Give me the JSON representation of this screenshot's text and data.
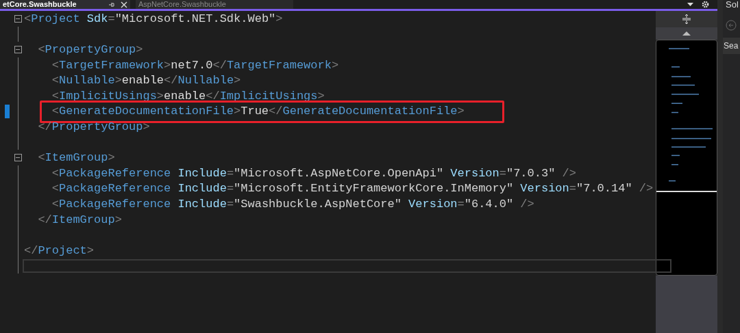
{
  "tabs": [
    {
      "label": "etCore.Swashbuckle",
      "selected": true
    },
    {
      "label": "AspNetCore.Swashbuckle",
      "selected": false
    }
  ],
  "code_lines": [
    {
      "foldable": true,
      "changed": false,
      "annotated": false,
      "current": false,
      "tokens": [
        {
          "kind": "punct",
          "text": "<"
        },
        {
          "kind": "tag",
          "text": "Project"
        },
        {
          "kind": "attr",
          "text": " Sdk"
        },
        {
          "kind": "punct",
          "text": "="
        },
        {
          "kind": "value",
          "text": "\"Microsoft.NET.Sdk.Web\""
        },
        {
          "kind": "punct",
          "text": ">"
        }
      ]
    },
    {
      "foldable": false,
      "changed": false,
      "annotated": false,
      "current": false
    },
    {
      "foldable": true,
      "changed": false,
      "annotated": false,
      "current": false,
      "tokens": [
        {
          "kind": "punct",
          "text": "  <"
        },
        {
          "kind": "tag",
          "text": "PropertyGroup"
        },
        {
          "kind": "punct",
          "text": ">"
        }
      ]
    },
    {
      "foldable": false,
      "changed": false,
      "annotated": false,
      "current": false,
      "tokens": [
        {
          "kind": "punct",
          "text": "    <"
        },
        {
          "kind": "tag",
          "text": "TargetFramework"
        },
        {
          "kind": "punct",
          "text": ">"
        },
        {
          "kind": "text",
          "text": "net7.0"
        },
        {
          "kind": "punct",
          "text": "</"
        },
        {
          "kind": "tag",
          "text": "TargetFramework"
        },
        {
          "kind": "punct",
          "text": ">"
        }
      ]
    },
    {
      "foldable": false,
      "changed": false,
      "annotated": false,
      "current": false,
      "tokens": [
        {
          "kind": "punct",
          "text": "    <"
        },
        {
          "kind": "tag",
          "text": "Nullable"
        },
        {
          "kind": "punct",
          "text": ">"
        },
        {
          "kind": "text",
          "text": "enable"
        },
        {
          "kind": "punct",
          "text": "</"
        },
        {
          "kind": "tag",
          "text": "Nullable"
        },
        {
          "kind": "punct",
          "text": ">"
        }
      ]
    },
    {
      "foldable": false,
      "changed": false,
      "annotated": false,
      "current": false,
      "tokens": [
        {
          "kind": "punct",
          "text": "    <"
        },
        {
          "kind": "tag",
          "text": "ImplicitUsings"
        },
        {
          "kind": "punct",
          "text": ">"
        },
        {
          "kind": "text",
          "text": "enable"
        },
        {
          "kind": "punct",
          "text": "</"
        },
        {
          "kind": "tag",
          "text": "ImplicitUsings"
        },
        {
          "kind": "punct",
          "text": ">"
        }
      ]
    },
    {
      "foldable": false,
      "changed": true,
      "annotated": true,
      "current": false,
      "tokens": [
        {
          "kind": "punct",
          "text": "    <"
        },
        {
          "kind": "tag",
          "text": "GenerateDocumentationFile"
        },
        {
          "kind": "punct",
          "text": ">"
        },
        {
          "kind": "text",
          "text": "True"
        },
        {
          "kind": "punct",
          "text": "</"
        },
        {
          "kind": "tag",
          "text": "GenerateDocumentationFile"
        },
        {
          "kind": "punct",
          "text": ">"
        }
      ]
    },
    {
      "foldable": false,
      "changed": false,
      "annotated": false,
      "current": false,
      "tokens": [
        {
          "kind": "punct",
          "text": "  </"
        },
        {
          "kind": "tag",
          "text": "PropertyGroup"
        },
        {
          "kind": "punct",
          "text": ">"
        }
      ]
    },
    {
      "foldable": false,
      "changed": false,
      "annotated": false,
      "current": false
    },
    {
      "foldable": true,
      "changed": false,
      "annotated": false,
      "current": false,
      "tokens": [
        {
          "kind": "punct",
          "text": "  <"
        },
        {
          "kind": "tag",
          "text": "ItemGroup"
        },
        {
          "kind": "punct",
          "text": ">"
        }
      ]
    },
    {
      "foldable": false,
      "changed": false,
      "annotated": false,
      "current": false,
      "tokens": [
        {
          "kind": "punct",
          "text": "    <"
        },
        {
          "kind": "tag",
          "text": "PackageReference"
        },
        {
          "kind": "attr",
          "text": " Include"
        },
        {
          "kind": "punct",
          "text": "="
        },
        {
          "kind": "value",
          "text": "\"Microsoft.AspNetCore.OpenApi\""
        },
        {
          "kind": "attr",
          "text": " Version"
        },
        {
          "kind": "punct",
          "text": "="
        },
        {
          "kind": "value",
          "text": "\"7.0.3\""
        },
        {
          "kind": "punct",
          "text": " />"
        }
      ]
    },
    {
      "foldable": false,
      "changed": false,
      "annotated": false,
      "current": false,
      "tokens": [
        {
          "kind": "punct",
          "text": "    <"
        },
        {
          "kind": "tag",
          "text": "PackageReference"
        },
        {
          "kind": "attr",
          "text": " Include"
        },
        {
          "kind": "punct",
          "text": "="
        },
        {
          "kind": "value",
          "text": "\"Microsoft.EntityFrameworkCore.InMemory\""
        },
        {
          "kind": "attr",
          "text": " Version"
        },
        {
          "kind": "punct",
          "text": "="
        },
        {
          "kind": "value",
          "text": "\"7.0.14\""
        },
        {
          "kind": "punct",
          "text": " />"
        }
      ]
    },
    {
      "foldable": false,
      "changed": false,
      "annotated": false,
      "current": false,
      "tokens": [
        {
          "kind": "punct",
          "text": "    <"
        },
        {
          "kind": "tag",
          "text": "PackageReference"
        },
        {
          "kind": "attr",
          "text": " Include"
        },
        {
          "kind": "punct",
          "text": "="
        },
        {
          "kind": "value",
          "text": "\"Swashbuckle.AspNetCore\""
        },
        {
          "kind": "attr",
          "text": " Version"
        },
        {
          "kind": "punct",
          "text": "="
        },
        {
          "kind": "value",
          "text": "\"6.4.0\""
        },
        {
          "kind": "punct",
          "text": " />"
        }
      ]
    },
    {
      "foldable": false,
      "changed": false,
      "annotated": false,
      "current": false,
      "tokens": [
        {
          "kind": "punct",
          "text": "  </"
        },
        {
          "kind": "tag",
          "text": "ItemGroup"
        },
        {
          "kind": "punct",
          "text": ">"
        }
      ]
    },
    {
      "foldable": false,
      "changed": false,
      "annotated": false,
      "current": false
    },
    {
      "foldable": false,
      "changed": false,
      "annotated": false,
      "current": false,
      "tokens": [
        {
          "kind": "punct",
          "text": "</"
        },
        {
          "kind": "tag",
          "text": "Project"
        },
        {
          "kind": "punct",
          "text": ">"
        }
      ]
    },
    {
      "foldable": false,
      "changed": false,
      "annotated": false,
      "current": true
    }
  ],
  "side_panel": {
    "title": "Sol",
    "search": {
      "value": "Sea"
    }
  }
}
